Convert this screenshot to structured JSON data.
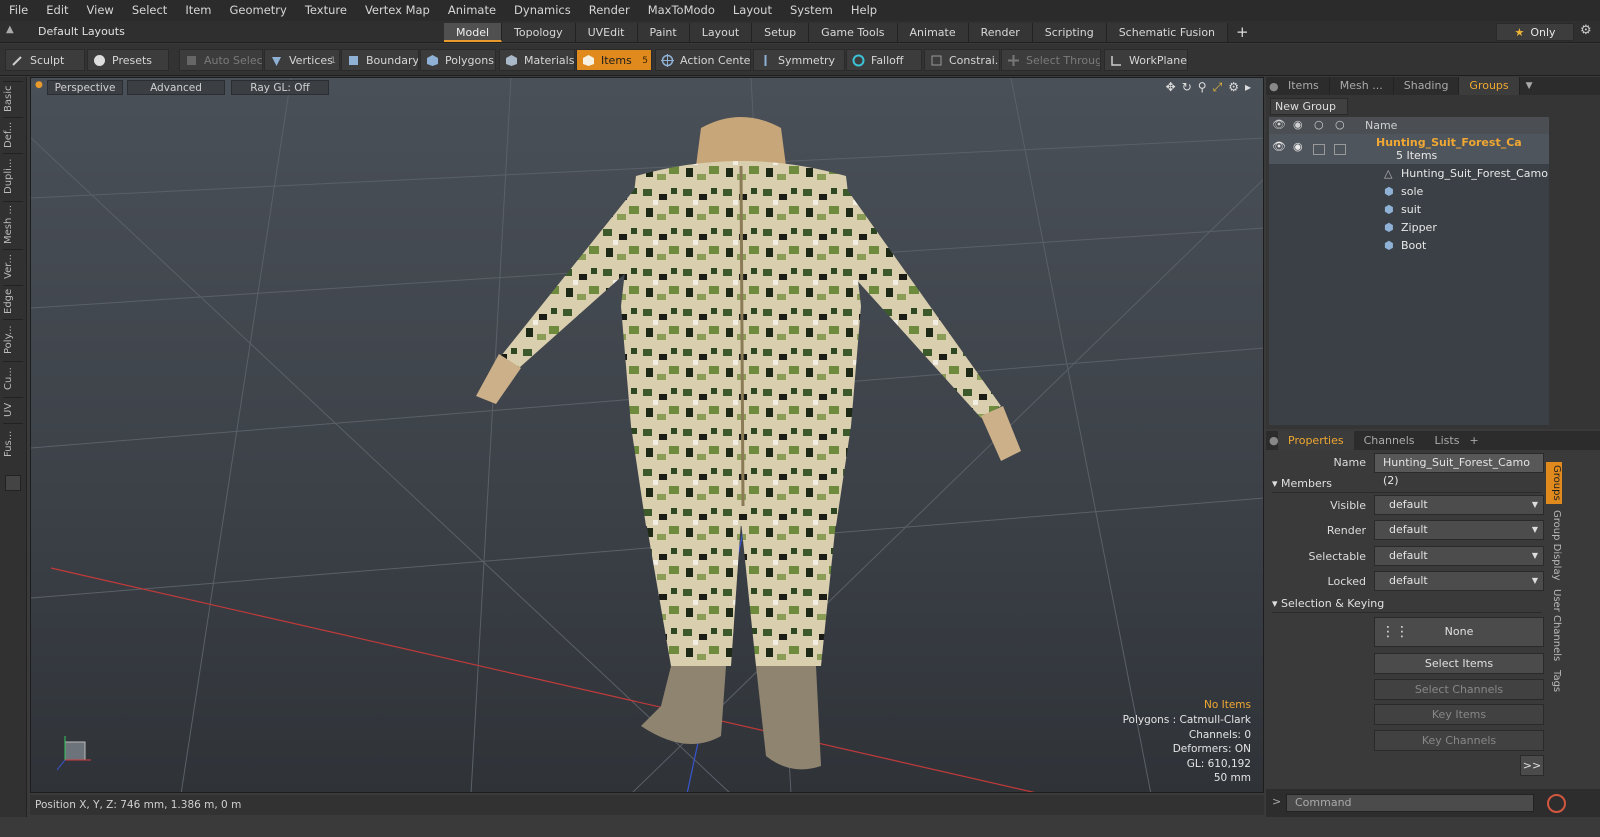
{
  "menu": [
    "File",
    "Edit",
    "View",
    "Select",
    "Item",
    "Geometry",
    "Texture",
    "Vertex Map",
    "Animate",
    "Dynamics",
    "Render",
    "MaxToModo",
    "Layout",
    "System",
    "Help"
  ],
  "layout_select": "Default Layouts",
  "tabs": [
    {
      "label": "Model",
      "active": true
    },
    {
      "label": "Topology",
      "active": false
    },
    {
      "label": "UVEdit",
      "active": false
    },
    {
      "label": "Paint",
      "active": false
    },
    {
      "label": "Layout",
      "active": false
    },
    {
      "label": "Setup",
      "active": false
    },
    {
      "label": "Game Tools",
      "active": false
    },
    {
      "label": "Animate",
      "active": false
    },
    {
      "label": "Render",
      "active": false
    },
    {
      "label": "Scripting",
      "active": false
    },
    {
      "label": "Schematic Fusion",
      "active": false
    }
  ],
  "only_label": "Only",
  "toolbar": {
    "sculpt": "Sculpt",
    "presets": "Presets",
    "auto_select": "Auto Select",
    "vertices": "Vertices",
    "vertices_count": "1",
    "boundary": "Boundary",
    "polygons": "Polygons",
    "materials": "Materials",
    "items": "Items",
    "items_count": "5",
    "action_center": "Action Center",
    "symmetry": "Symmetry",
    "falloff": "Falloff",
    "constraints": "Constrai...",
    "select_through": "Select Through",
    "workplane": "WorkPlane"
  },
  "left_tabs": [
    "Basic",
    "Def...",
    "Dupli...",
    "Mesh ...",
    "Ver...",
    "Edge",
    "Poly...",
    "Cu...",
    "UV",
    "Fus..."
  ],
  "viewport": {
    "perspective": "Perspective",
    "advanced": "Advanced",
    "raygl": "Ray GL: Off",
    "info": {
      "no_items": "No Items",
      "polygons": "Polygons : Catmull-Clark",
      "channels": "Channels: 0",
      "deformers": "Deformers: ON",
      "gl": "GL: 610,192",
      "scale": "50 mm"
    }
  },
  "status": "Position X, Y, Z:  746 mm, 1.386 m, 0 m",
  "groups_panel": {
    "tabs": [
      {
        "label": "Items",
        "active": false
      },
      {
        "label": "Mesh ...",
        "active": false
      },
      {
        "label": "Shading",
        "active": false
      },
      {
        "label": "Groups",
        "active": true
      }
    ],
    "new_group": "New Group",
    "name_header": "Name",
    "group_name": "Hunting_Suit_Forest_Ca",
    "group_count": "5 Items",
    "children": [
      "Hunting_Suit_Forest_Camo",
      "sole",
      "suit",
      "Zipper",
      "Boot"
    ]
  },
  "properties": {
    "tabs": [
      {
        "label": "Properties",
        "active": true
      },
      {
        "label": "Channels",
        "active": false
      },
      {
        "label": "Lists",
        "active": false
      }
    ],
    "name_label": "Name",
    "name_value": "Hunting_Suit_Forest_Camo (2)",
    "members": "Members",
    "visible_label": "Visible",
    "visible": "default",
    "render_label": "Render",
    "render": "default",
    "selectable_label": "Selectable",
    "selectable": "default",
    "locked_label": "Locked",
    "locked": "default",
    "sel_keying": "Selection & Keying",
    "none": "None",
    "select_items": "Select Items",
    "select_channels": "Select Channels",
    "key_items": "Key Items",
    "key_channels": "Key Channels",
    "more": ">>"
  },
  "side_tabs": [
    "Groups",
    "Group Display",
    "User Channels",
    "Tags"
  ],
  "command_placeholder": "Command",
  "colors": {
    "accent": "#e08a1e",
    "group_orange": "#f0a832"
  }
}
